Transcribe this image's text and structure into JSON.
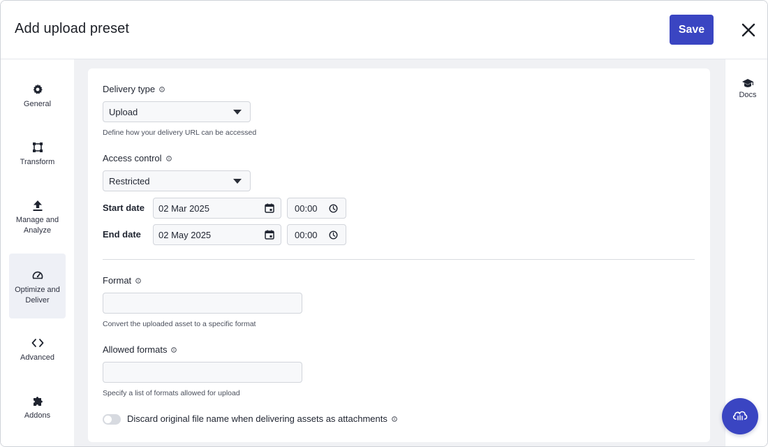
{
  "header": {
    "title": "Add upload preset",
    "save_label": "Save",
    "close_icon": "close-icon"
  },
  "sidebar": {
    "items": [
      {
        "label": "General",
        "icon": "gear-icon",
        "active": false
      },
      {
        "label": "Transform",
        "icon": "crop-icon",
        "active": false
      },
      {
        "label": "Manage and Analyze",
        "icon": "upload-icon",
        "active": false
      },
      {
        "label": "Optimize and Deliver",
        "icon": "speedometer-icon",
        "active": true
      },
      {
        "label": "Advanced",
        "icon": "code-icon",
        "active": false
      },
      {
        "label": "Addons",
        "icon": "puzzle-icon",
        "active": false
      }
    ]
  },
  "form": {
    "delivery_type": {
      "label": "Delivery type",
      "value": "Upload",
      "hint": "Define how your delivery URL can be accessed"
    },
    "access_control": {
      "label": "Access control",
      "value": "Restricted"
    },
    "start_date": {
      "label": "Start date",
      "date": "02 Mar 2025",
      "time": "00:00"
    },
    "end_date": {
      "label": "End date",
      "date": "02 May 2025",
      "time": "00:00"
    },
    "format": {
      "label": "Format",
      "value": "",
      "hint": "Convert the uploaded asset to a specific format"
    },
    "allowed_formats": {
      "label": "Allowed formats",
      "value": "",
      "hint": "Specify a list of formats allowed for upload"
    },
    "discard_filename": {
      "label": "Discard original file name when delivering assets as attachments",
      "enabled": false
    }
  },
  "rail": {
    "docs_label": "Docs",
    "docs_icon": "graduation-cap-icon"
  },
  "fab": {
    "icon": "cloud-icon"
  },
  "colors": {
    "accent": "#3a45c2",
    "background": "#f0f1f4",
    "active_nav": "#eef0f6"
  }
}
